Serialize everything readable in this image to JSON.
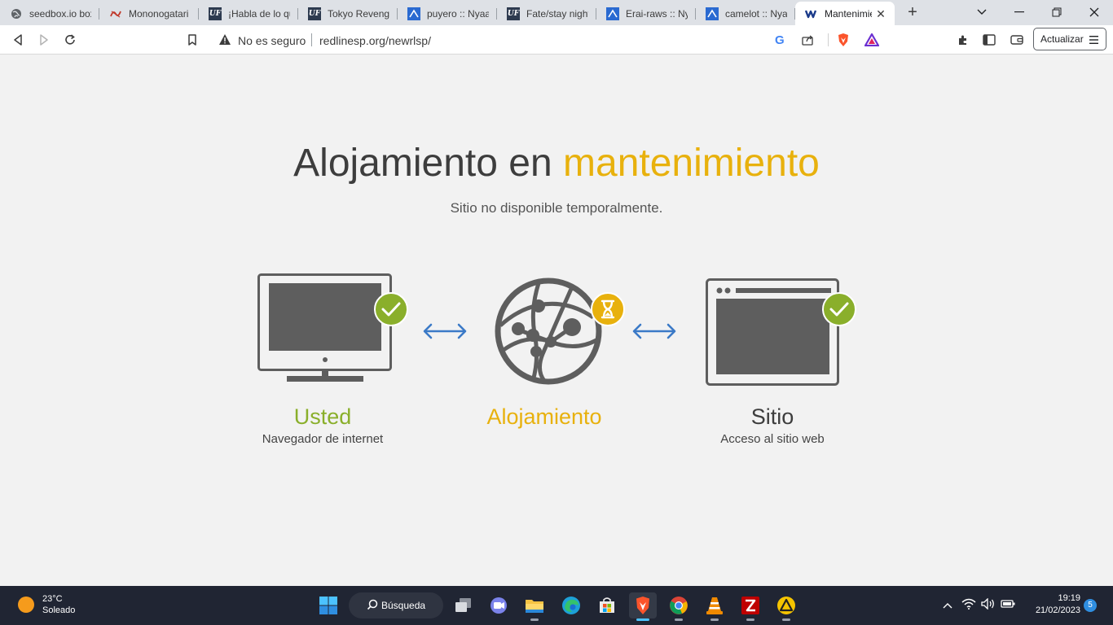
{
  "tabs": [
    {
      "title": "seedbox.io box",
      "icon": "globe-icon"
    },
    {
      "title": "Mononogatari -",
      "icon": "mononogatari-icon"
    },
    {
      "title": "¡Habla de lo que",
      "icon": "uf-icon"
    },
    {
      "title": "Tokyo Revenger",
      "icon": "uf-icon"
    },
    {
      "title": "puyero :: Nyaa",
      "icon": "nyaa-icon"
    },
    {
      "title": "Fate/stay night",
      "icon": "uf-icon"
    },
    {
      "title": "Erai-raws :: Nyaa",
      "icon": "nyaa-icon"
    },
    {
      "title": "camelot :: Nyaa",
      "icon": "nyaa-icon"
    },
    {
      "title": "Mantenimie",
      "icon": "webempresa-icon",
      "active": true
    }
  ],
  "toolbar": {
    "security_label": "No es seguro",
    "url": "redlinesp.org/newrlsp/",
    "update_button": "Actualizar"
  },
  "page": {
    "headline_part1": "Alojamiento en ",
    "headline_part2": "mantenimiento",
    "subheadline": "Sitio no disponible temporalmente.",
    "nodes": [
      {
        "title": "Usted",
        "subtitle": "Navegador de internet",
        "status": "ok"
      },
      {
        "title": "Alojamiento",
        "subtitle": "",
        "status": "pending"
      },
      {
        "title": "Sitio",
        "subtitle": "Acceso al sitio web",
        "status": "ok"
      }
    ],
    "colors": {
      "ok": "#8aaf2b",
      "pending": "#e8b10d",
      "text": "#3d3d3d",
      "icon": "#5e5e5e",
      "arrow": "#3b7ac7"
    }
  },
  "taskbar": {
    "weather_temp": "23°C",
    "weather_desc": "Soleado",
    "search_label": "Búsqueda",
    "time": "19:19",
    "date": "21/02/2023",
    "notification_count": "5"
  }
}
